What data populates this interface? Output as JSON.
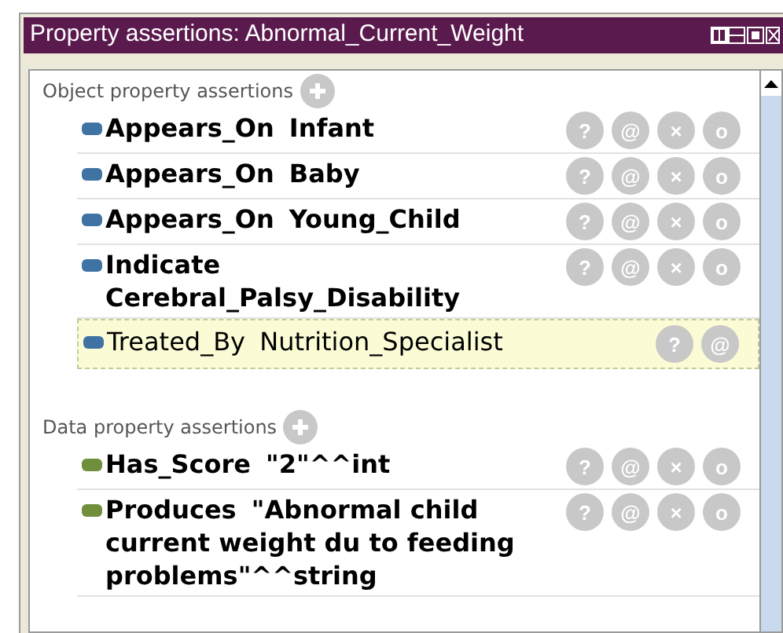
{
  "window": {
    "title": "Property assertions: Abnormal_Current_Weight"
  },
  "sections": [
    {
      "kind": "object",
      "title": "Object property assertions",
      "items": [
        {
          "property": "Appears_On",
          "value": "Infant",
          "inferred": false,
          "buttons": [
            "?",
            "@",
            "×",
            "o"
          ]
        },
        {
          "property": "Appears_On",
          "value": "Baby",
          "inferred": false,
          "buttons": [
            "?",
            "@",
            "×",
            "o"
          ]
        },
        {
          "property": "Appears_On",
          "value": "Young_Child",
          "inferred": false,
          "buttons": [
            "?",
            "@",
            "×",
            "o"
          ]
        },
        {
          "property": "Indicate",
          "value": "Cerebral_Palsy_Disability",
          "inferred": false,
          "buttons": [
            "?",
            "@",
            "×",
            "o"
          ]
        },
        {
          "property": "Treated_By",
          "value": "Nutrition_Specialist",
          "inferred": true,
          "buttons": [
            "?",
            "@"
          ]
        }
      ]
    },
    {
      "kind": "data",
      "title": "Data property assertions",
      "items": [
        {
          "property": "Has_Score",
          "value": "\"2\"^^int",
          "inferred": false,
          "buttons": [
            "?",
            "@",
            "×",
            "o"
          ]
        },
        {
          "property": "Produces",
          "value": "\"Abnormal child current weight du to feeding problems\"^^string",
          "inferred": false,
          "buttons": [
            "?",
            "@",
            "×",
            "o"
          ]
        }
      ]
    }
  ]
}
